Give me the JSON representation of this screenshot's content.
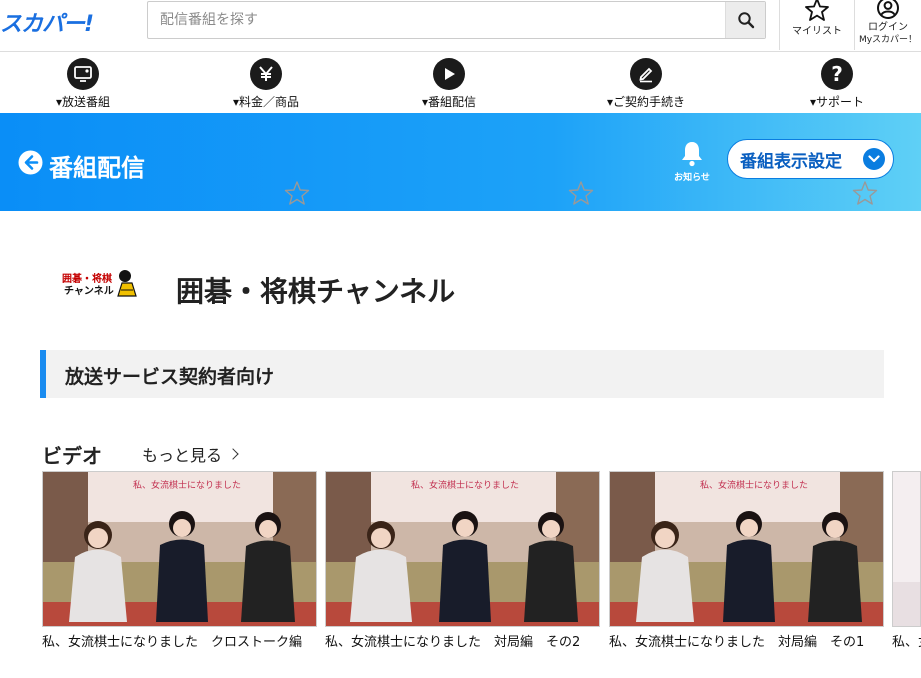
{
  "header": {
    "logo": "スカパー!",
    "search_placeholder": "配信番組を探す",
    "mylist_label": "マイリスト",
    "login_label_1": "ログイン",
    "login_label_2": "Myスカパー！"
  },
  "nav": {
    "items": [
      {
        "label": "▾放送番組",
        "icon": "tv-icon"
      },
      {
        "label": "▾料金／商品",
        "icon": "yen-icon"
      },
      {
        "label": "▾番組配信",
        "icon": "play-icon"
      },
      {
        "label": "▾ご契約手続き",
        "icon": "pen-icon"
      },
      {
        "label": "▾サポート",
        "icon": "help-icon"
      }
    ]
  },
  "banner": {
    "title": "番組配信",
    "notice_label": "お知らせ",
    "setting_label": "番組表示設定"
  },
  "channel": {
    "logo_text_1": "囲碁・将棋",
    "logo_text_2": "チャンネル",
    "name": "囲碁・将棋チャンネル"
  },
  "section": {
    "title": "放送サービス契約者向け"
  },
  "videos": {
    "heading": "ビデオ",
    "more_label": "もっと見る",
    "thumb_caption": "私、女流棋士になりました",
    "items": [
      {
        "title": "私、女流棋士になりました　クロストーク編"
      },
      {
        "title": "私、女流棋士になりました　対局編　その2"
      },
      {
        "title": "私、女流棋士になりました　対局編　その1"
      },
      {
        "title": "私、女"
      }
    ]
  },
  "colors": {
    "brand": "#1a6fe0",
    "banner_start": "#0a8ef7",
    "banner_end": "#5fd0f6",
    "section_accent": "#1a8cf0"
  }
}
